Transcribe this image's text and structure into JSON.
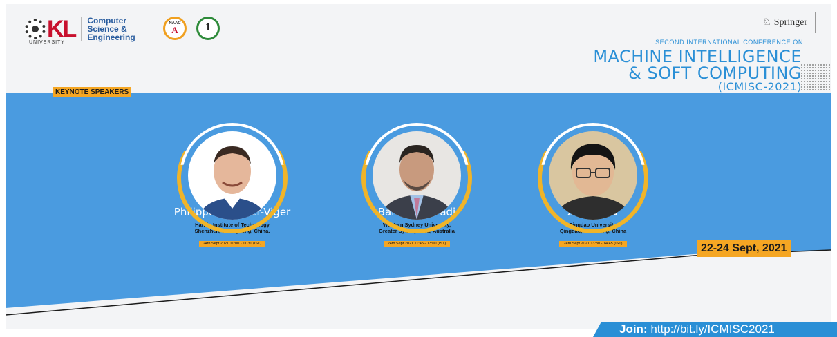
{
  "header": {
    "university_logo_text": "KL",
    "university_logo_subtext": "UNIVERSITY",
    "department": "Computer\nScience &\nEngineering",
    "naac_text": "NAAC",
    "naac_grade": "A",
    "rank_text": "1",
    "publisher": "Springer"
  },
  "conference": {
    "subtitle": "SECOND INTERNATIONAL CONFERENCE ON",
    "title_line1": "MACHINE INTELLIGENCE",
    "title_line2": "& SOFT COMPUTING",
    "title_line3": "(ICMISC-2021)"
  },
  "section_label": "KEYNOTE SPEAKERS",
  "speakers": [
    {
      "name": "Philippe Fournier-Viger",
      "affiliation_line1": "Harbin Institute of Technology",
      "affiliation_line2": "Shenzhen, Guangdong, China.",
      "session": "24th Sept 2021  10:00 - 11:30 (IST)"
    },
    {
      "name": "Bahman Javadi",
      "affiliation_line1": "Western Sydney University,",
      "affiliation_line2": "Greater Sydney Area, Australia",
      "session": "24th Sept 2021  11:45 - 13:00 (IST)"
    },
    {
      "name": "Zhihan Lv",
      "affiliation_line1": "Qingdao University,",
      "affiliation_line2": "Qingdao, Shandong, China",
      "session": "24th Sept 2021  13:30 - 14:45 (IST)"
    }
  ],
  "dates": "22-24 Sept, 2021",
  "join": {
    "label": "Join:",
    "url": "http://bit.ly/ICMISC2021"
  },
  "colors": {
    "blue": "#4a9be0",
    "accent_orange": "#f5a623",
    "title_blue": "#2a8fd6"
  }
}
